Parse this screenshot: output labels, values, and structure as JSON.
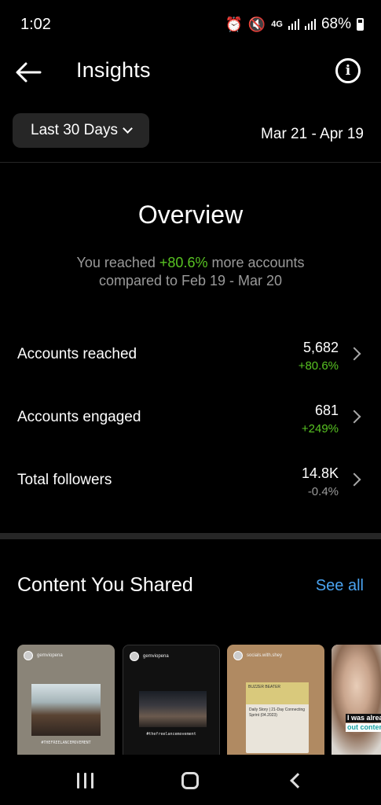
{
  "status_bar": {
    "time": "1:02",
    "network": "4G",
    "battery": "68%"
  },
  "header": {
    "title": "Insights"
  },
  "filter": {
    "selected": "Last 30 Days",
    "date_range": "Mar 21 - Apr 19"
  },
  "overview": {
    "title": "Overview",
    "summary_prefix": "You reached ",
    "summary_change": "+80.6%",
    "summary_suffix": " more accounts",
    "summary_line2": "compared to Feb 19 - Mar 20"
  },
  "metrics": [
    {
      "label": "Accounts reached",
      "value": "5,682",
      "change": "+80.6%"
    },
    {
      "label": "Accounts engaged",
      "value": "681",
      "change": "+249%"
    },
    {
      "label": "Total followers",
      "value": "14.8K",
      "change": "-0.4%"
    }
  ],
  "content": {
    "title": "Content You Shared",
    "see_all": "See all",
    "thumbnails": [
      {
        "user": "gemviopena",
        "caption": "#THEFREELANCEMOVEMENT"
      },
      {
        "user": "gemviopena",
        "caption": "#thefreelancemovement"
      },
      {
        "user": "socials.with.shey",
        "title": "BUZZER BEATER",
        "card_title": "Daily Story | 21-Day Connecting Sprint (04.2023)"
      },
      {
        "overlay_line1": "I was alrea",
        "overlay_line2": "out conten"
      }
    ]
  },
  "colors": {
    "background": "#000000",
    "positive": "#58c322",
    "neutral": "#9a9a9a",
    "link": "#4aa3f0",
    "surface": "#262626"
  },
  "icons": [
    "back-arrow-icon",
    "info-icon",
    "chevron-down-icon",
    "chevron-right-icon",
    "recents-icon",
    "home-icon",
    "nav-back-icon"
  ]
}
